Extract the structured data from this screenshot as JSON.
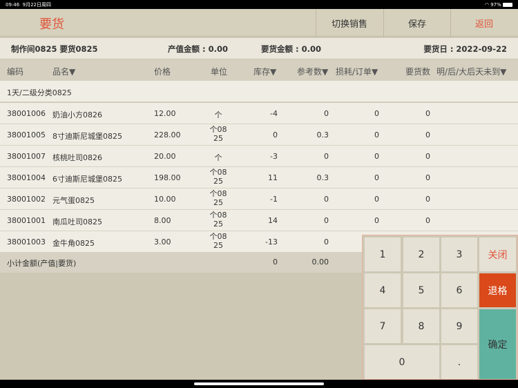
{
  "status": {
    "time": "09:46",
    "date": "9月22日周四",
    "battery": "97%"
  },
  "header": {
    "title": "要货",
    "switch_sales": "切换销售",
    "save": "保存",
    "back": "返回"
  },
  "info": {
    "store": "制作间0825 要货0825",
    "output_amount": "产值金额 : 0.00",
    "order_amount": "要货金额 : 0.00",
    "order_date": "要货日 : 2022-09-22"
  },
  "columns": [
    "编码",
    "品名▼",
    "价格",
    "单位",
    "库存▼",
    "参考数▼",
    "损耗/订单▼",
    "要货数",
    "明/后/大后天未到▼"
  ],
  "group": "1天/二级分类0825",
  "rows": [
    {
      "code": "38001006",
      "name": "奶油小方0826",
      "price": "12.00",
      "unit": "个",
      "stock": "-4",
      "ref": "0",
      "loss": "0",
      "qty": "0"
    },
    {
      "code": "38001005",
      "name": "8寸迪斯尼城堡0825",
      "price": "228.00",
      "unit": "个0825",
      "stock": "0",
      "ref": "0.3",
      "loss": "0",
      "qty": "0"
    },
    {
      "code": "38001007",
      "name": "核桃吐司0826",
      "price": "20.00",
      "unit": "个",
      "stock": "-3",
      "ref": "0",
      "loss": "0",
      "qty": "0"
    },
    {
      "code": "38001004",
      "name": "6寸迪斯尼城堡0825",
      "price": "198.00",
      "unit": "个0825",
      "stock": "11",
      "ref": "0.3",
      "loss": "0",
      "qty": "0"
    },
    {
      "code": "38001002",
      "name": "元气蛋0825",
      "price": "10.00",
      "unit": "个0825",
      "stock": "-1",
      "ref": "0",
      "loss": "0",
      "qty": "0"
    },
    {
      "code": "38001001",
      "name": "南瓜吐司0825",
      "price": "8.00",
      "unit": "个0825",
      "stock": "14",
      "ref": "0",
      "loss": "0",
      "qty": "0"
    },
    {
      "code": "38001003",
      "name": "金牛角0825",
      "price": "3.00",
      "unit": "个0825",
      "stock": "-13",
      "ref": "0",
      "loss": "",
      "qty": ""
    }
  ],
  "subtotal": {
    "label": "小计金额(产值|要货)",
    "stock": "0",
    "amount": "0.00"
  },
  "keypad": {
    "k1": "1",
    "k2": "2",
    "k3": "3",
    "close": "关闭",
    "k4": "4",
    "k5": "5",
    "k6": "6",
    "backspace": "退格",
    "k7": "7",
    "k8": "8",
    "k9": "9",
    "confirm": "确定",
    "k0": "0",
    "dot": "."
  },
  "colors": {
    "accent": "#e0553a",
    "backspace": "#d9491a",
    "confirm": "#5fb2a0"
  }
}
